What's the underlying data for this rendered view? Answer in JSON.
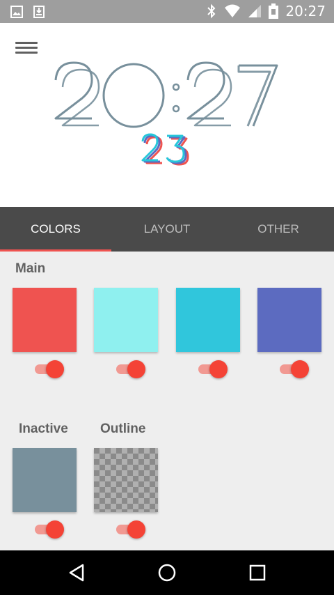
{
  "status_bar": {
    "time": "20:27",
    "icons": [
      "image-icon",
      "download-icon",
      "bluetooth-icon",
      "wifi-icon",
      "signal-icon",
      "battery-icon"
    ]
  },
  "preview": {
    "hours": "20",
    "minutes": "27",
    "seconds": "23",
    "clock_color": "#78909c",
    "seconds_colors": [
      "#26c6da",
      "#5c6bc0",
      "#ef5350"
    ]
  },
  "tabs": [
    {
      "label": "COLORS",
      "active": true
    },
    {
      "label": "LAYOUT",
      "active": false
    },
    {
      "label": "OTHER",
      "active": false
    }
  ],
  "sections": {
    "main": {
      "label": "Main",
      "swatches": [
        {
          "color": "#ef5350",
          "enabled": true
        },
        {
          "color": "#8ff0ef",
          "enabled": true
        },
        {
          "color": "#30c6dc",
          "enabled": true
        },
        {
          "color": "#5c6bc0",
          "enabled": true
        }
      ]
    },
    "inactive": {
      "label": "Inactive",
      "color": "#78909c",
      "enabled": true
    },
    "outline": {
      "label": "Outline",
      "color": "transparent",
      "enabled": true
    }
  },
  "toggle_color": "#f44336",
  "nav": [
    "back-icon",
    "home-icon",
    "recents-icon"
  ]
}
